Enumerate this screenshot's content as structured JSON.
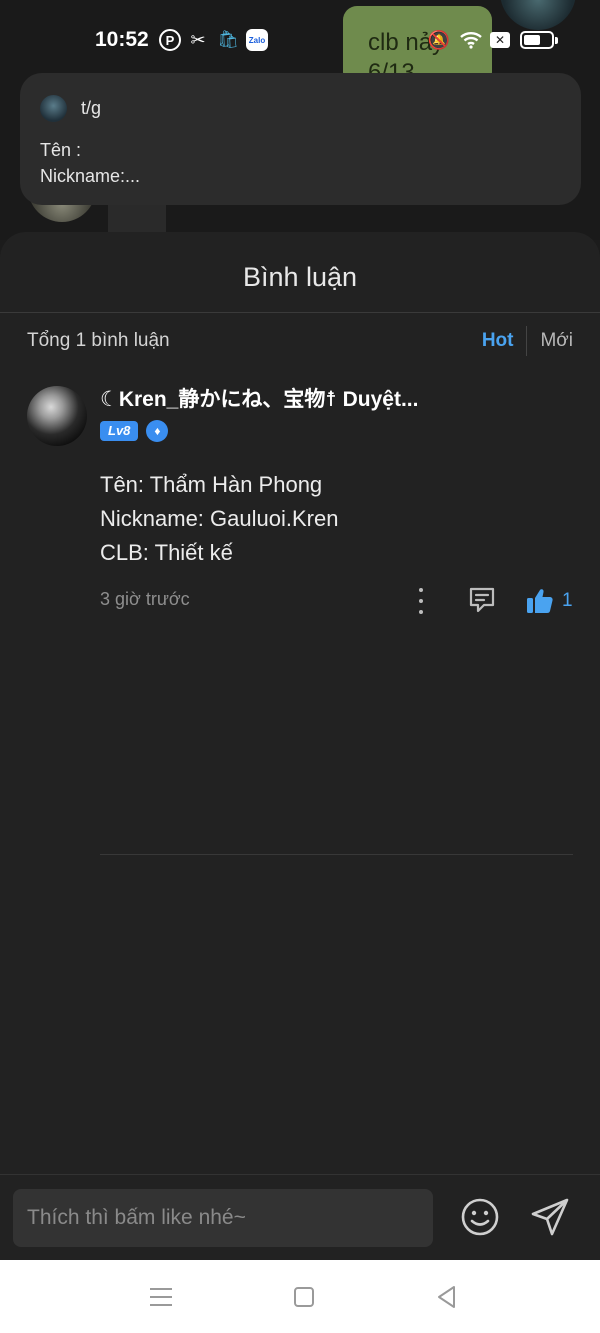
{
  "status_bar": {
    "time": "10:52",
    "app_icons": [
      "pinterest-icon",
      "capcut-icon",
      "shopping-bag-icon",
      "zalo-icon"
    ],
    "zalo_label": "Zalo",
    "system_icons": [
      "mute-icon",
      "wifi-icon",
      "x-icon",
      "battery-icon"
    ],
    "battery_level": 0.6
  },
  "background": {
    "chat_bubble_text": "clb nảy\n6/13"
  },
  "post": {
    "author": "t/g",
    "body": "Tên :\nNickname:..."
  },
  "comments_sheet": {
    "title": "Bình luận",
    "total_label": "Tổng 1 bình luận",
    "sort_options": [
      "Hot",
      "Mới"
    ],
    "sort_selected": "Hot"
  },
  "comment": {
    "author": "☾Kren_静かにね、宝物☨ Duyệt...",
    "level_badge": "Lv8",
    "text": "Tên: Thẩm Hàn Phong\nNickname: Gauluoi.Kren\nCLB: Thiết kế",
    "time": "3 giờ trước",
    "like_count": "1",
    "liked": true
  },
  "input": {
    "placeholder": "Thích thì bấm like nhé~"
  },
  "colors": {
    "accent": "#4aa3f0",
    "sheet_background": "#222222",
    "card_background": "#2c2c2c"
  }
}
